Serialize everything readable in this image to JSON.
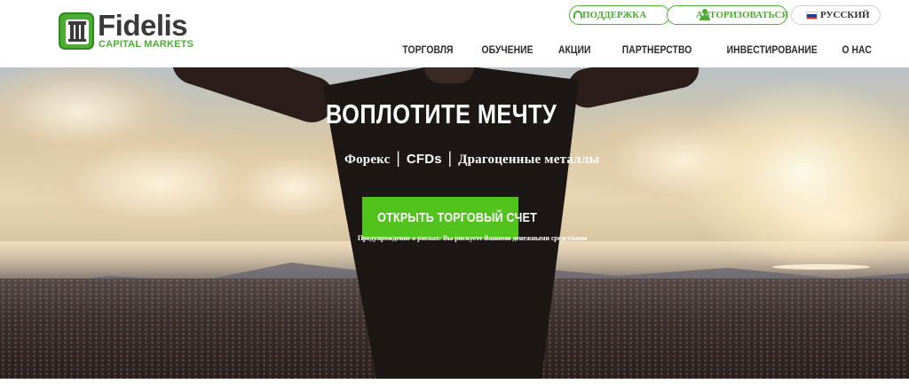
{
  "brand": {
    "name": "Fidelis",
    "tagline": "CAPITAL MARKETS",
    "accent_color": "#4cad32"
  },
  "top_bar": {
    "support_label": "ПОДДЕРЖКА",
    "login_label": "АВТОРИЗОВАТЬСЯ",
    "language_label": "РУССКИЙ",
    "support_icon": "headset-icon",
    "login_icon": "user-icon",
    "language_icon": "russia-flag-icon"
  },
  "nav": {
    "items": [
      {
        "label": "ТОРГОВЛЯ"
      },
      {
        "label": "ОБУЧЕНИЕ"
      },
      {
        "label": "АКЦИИ"
      },
      {
        "label": "ПАРТНЕРСТВО"
      },
      {
        "label": "ИНВЕСТИРОВАНИЕ"
      },
      {
        "label": "О НАС"
      }
    ]
  },
  "hero": {
    "title": "ВОПЛОТИТЕ МЕЧТУ",
    "sub_item_1": "Форекс",
    "sub_sep_1": "|",
    "sub_item_2": "CFDs",
    "sub_sep_2": "|",
    "sub_item_3": "Драгоценные металлы",
    "cta_label": "ОТКРЫТЬ ТОРГОВЫЙ СЧЕТ",
    "cta_color": "#52c21c",
    "risk_warning": "Предупреждение о рисках: Вы рискуете Вашими денежными средствами"
  }
}
